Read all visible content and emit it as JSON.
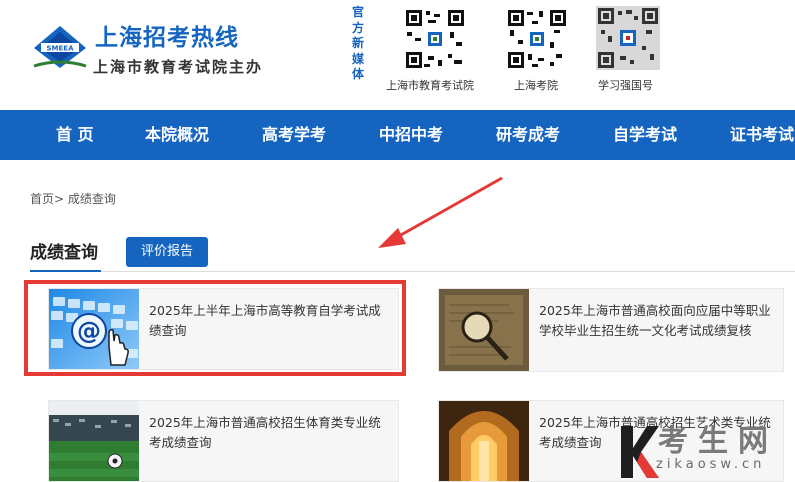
{
  "header": {
    "title": "上海招考热线",
    "subtitle": "上海市教育考试院主办",
    "emblem_text": "SMEEA",
    "media_label": "官方新媒体",
    "qr_codes": [
      {
        "caption": "上海市教育考试院"
      },
      {
        "caption": "上海考院"
      },
      {
        "caption": "学习强国号"
      }
    ]
  },
  "nav": {
    "items": [
      {
        "label": "首 页"
      },
      {
        "label": "本院概况"
      },
      {
        "label": "高考学考"
      },
      {
        "label": "中招中考"
      },
      {
        "label": "研考成考"
      },
      {
        "label": "自学考试"
      },
      {
        "label": "证书考试"
      }
    ]
  },
  "breadcrumb": {
    "home": "首页",
    "separator": ">",
    "current": "成绩查询"
  },
  "section": {
    "title": "成绩查询",
    "report_button": "评价报告"
  },
  "cards": [
    {
      "text": "2025年上半年上海市高等教育自学考试成绩查询",
      "thumb_icon": "at-keyboard-icon"
    },
    {
      "text": "2025年上海市普通高校面向应届中等职业学校毕业生招生统一文化考试成绩复核",
      "thumb_icon": "magnifier-icon"
    },
    {
      "text": "2025年上海市普通高校招生体育类专业统考成绩查询",
      "thumb_icon": "stadium-icon"
    },
    {
      "text": "2025年上海市普通高校招生艺术类专业统考成绩查询",
      "thumb_icon": "arch-icon"
    }
  ],
  "watermark": {
    "text": "考生网",
    "url": "zikaosw.cn"
  },
  "colors": {
    "brand_blue": "#1565c0",
    "highlight_red": "#e53935"
  }
}
